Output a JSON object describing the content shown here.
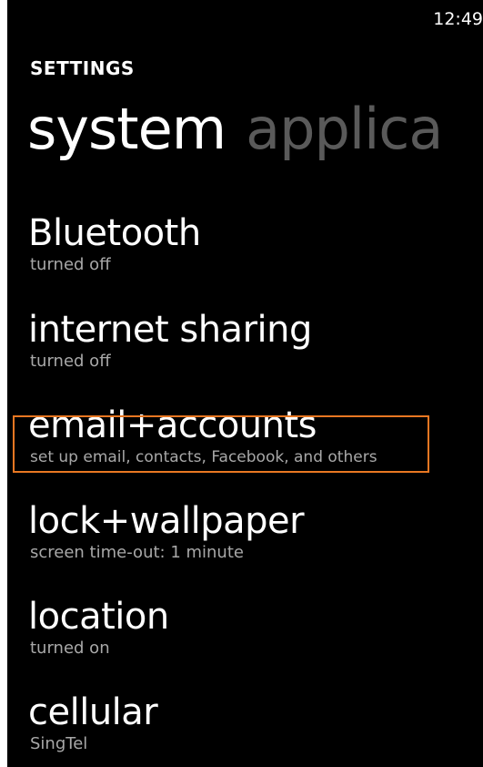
{
  "status_bar": {
    "time": "12:49"
  },
  "app_title": "SETTINGS",
  "pivot": {
    "active": "system",
    "next": "applica"
  },
  "items": [
    {
      "title": "Bluetooth",
      "subtitle": "turned off"
    },
    {
      "title": "internet sharing",
      "subtitle": "turned off"
    },
    {
      "title": "email+accounts",
      "subtitle": "set up email, contacts, Facebook, and others"
    },
    {
      "title": "lock+wallpaper",
      "subtitle": "screen time-out: 1 minute"
    },
    {
      "title": "location",
      "subtitle": "turned on"
    },
    {
      "title": "cellular",
      "subtitle": "SingTel"
    }
  ],
  "highlighted_item": "email+accounts",
  "colors": {
    "background": "#000000",
    "text": "#ffffff",
    "subtext": "#a8a8a8",
    "inactive_pivot": "#5a5a5a",
    "highlight_border": "#e87722"
  }
}
